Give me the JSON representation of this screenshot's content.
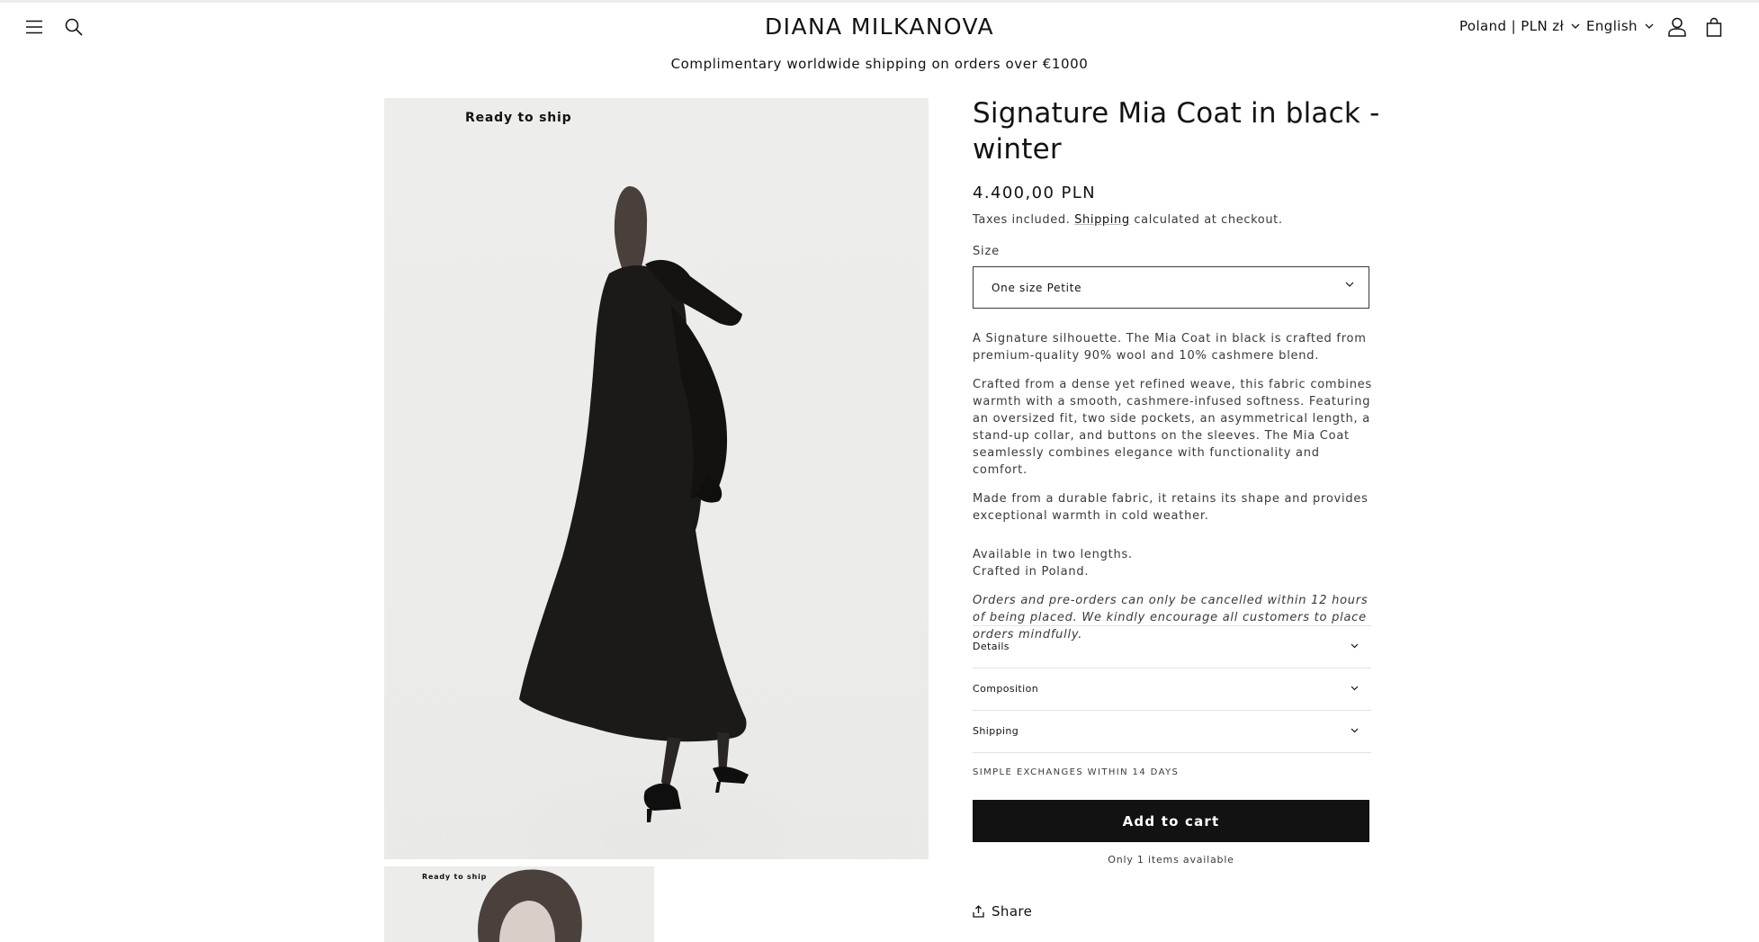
{
  "header": {
    "brand": "DIANA MILKANOVA",
    "country_selector": "Poland | PLN zł",
    "language_selector": "English",
    "icons": [
      "hamburger-menu-icon",
      "search-icon",
      "account-icon",
      "cart-icon"
    ]
  },
  "announcement": "Complimentary worldwide shipping on orders over €1000",
  "media": {
    "main_badge": "Ready to ship",
    "thumb_badge": "Ready to ship"
  },
  "product": {
    "title": "Signature Mia Coat in black - winter",
    "price": "4.400,00 PLN",
    "tax_prefix": "Taxes included. ",
    "tax_link": "Shipping",
    "tax_suffix": " calculated at checkout.",
    "size_label": "Size",
    "size_selected": "One size Petite",
    "description": {
      "p1": " A Signature silhouette. The Mia Coat in black is crafted from premium-quality 90% wool and 10% cashmere blend.",
      "p2": "Crafted from a dense yet refined weave, this fabric combines warmth with a smooth, cashmere-infused softness. Featuring an oversized fit, two side pockets, an asymmetrical length, a stand-up collar, and buttons on the sleeves. The Mia Coat seamlessly combines elegance with functionality and comfort.",
      "p3": "Made from a durable fabric, it retains its shape and provides exceptional warmth in cold weather.",
      "p4_line1": "Available in two lengths.",
      "p4_line2": "Crafted in Poland.",
      "p5": "Orders and pre-orders can only be cancelled within 12 hours of being placed. We kindly encourage all customers to place orders mindfully."
    },
    "accordions": {
      "details": "Details",
      "composition": "Composition",
      "shipping": "Shipping"
    },
    "exchanges_note": "SIMPLE EXCHANGES WITHIN 14 DAYS",
    "add_to_cart": "Add to cart",
    "availability": "Only 1 items available",
    "share": "Share"
  },
  "colors": {
    "text": "#121212",
    "button_bg": "#121212",
    "button_text": "#ffffff",
    "image_bg": "#ececea"
  }
}
